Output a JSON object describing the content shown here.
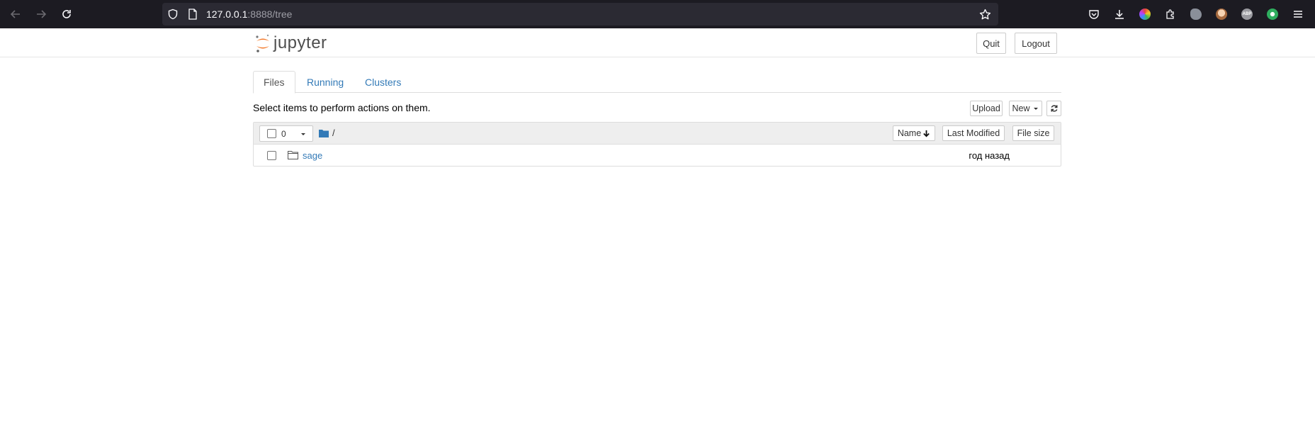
{
  "browser": {
    "url_host": "127.0.0.1",
    "url_rest": ":8888/tree",
    "icons": [
      "back-arrow-icon",
      "forward-arrow-icon",
      "reload-icon",
      "shield-icon",
      "page-icon",
      "bookmark-star-icon",
      "pocket-icon",
      "download-icon",
      "extension-color-icon",
      "puzzle-icon",
      "extension-cloud-icon",
      "extension-face-icon",
      "abp-icon",
      "extension-green-icon",
      "hamburger-menu-icon"
    ],
    "abp_label": "ABP"
  },
  "header": {
    "logo_text": "jupyter",
    "quit_label": "Quit",
    "logout_label": "Logout"
  },
  "tabs": [
    {
      "label": "Files",
      "active": true
    },
    {
      "label": "Running",
      "active": false
    },
    {
      "label": "Clusters",
      "active": false
    }
  ],
  "toolbar": {
    "hint": "Select items to perform actions on them.",
    "upload_label": "Upload",
    "new_label": "New"
  },
  "list_header": {
    "selected_count": "0",
    "breadcrumb": "/",
    "col_name": "Name",
    "col_modified": "Last Modified",
    "col_size": "File size"
  },
  "files": [
    {
      "name": "sage",
      "type": "folder",
      "modified": "год назад",
      "size": ""
    }
  ],
  "colors": {
    "link": "#337ab7",
    "logo_orange": "#f37726",
    "browser_bg": "#1c1b22"
  }
}
